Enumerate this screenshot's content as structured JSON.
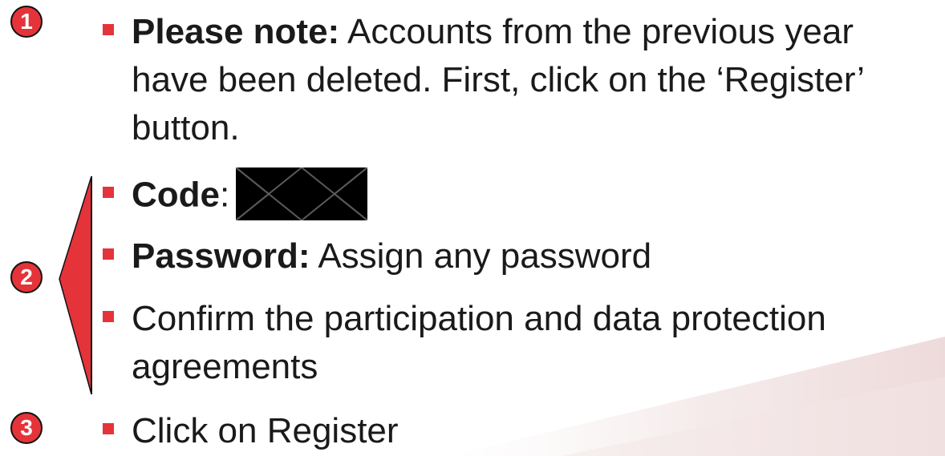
{
  "badges": [
    "1",
    "2",
    "3"
  ],
  "items": {
    "note": {
      "label": "Please note:",
      "lines": [
        " Accounts from the previous year",
        "have been deleted. First, click on the ‘Register’",
        "button."
      ]
    },
    "code": {
      "label": "Code",
      "separator": ":"
    },
    "password": {
      "label": "Password:",
      "text": " Assign any password"
    },
    "confirm": {
      "lines": [
        "Confirm the participation and data protection",
        "agreements"
      ]
    },
    "register": {
      "text": "Click on Register"
    }
  },
  "colors": {
    "accent": "#e5333a",
    "text": "#1a1a1a"
  }
}
